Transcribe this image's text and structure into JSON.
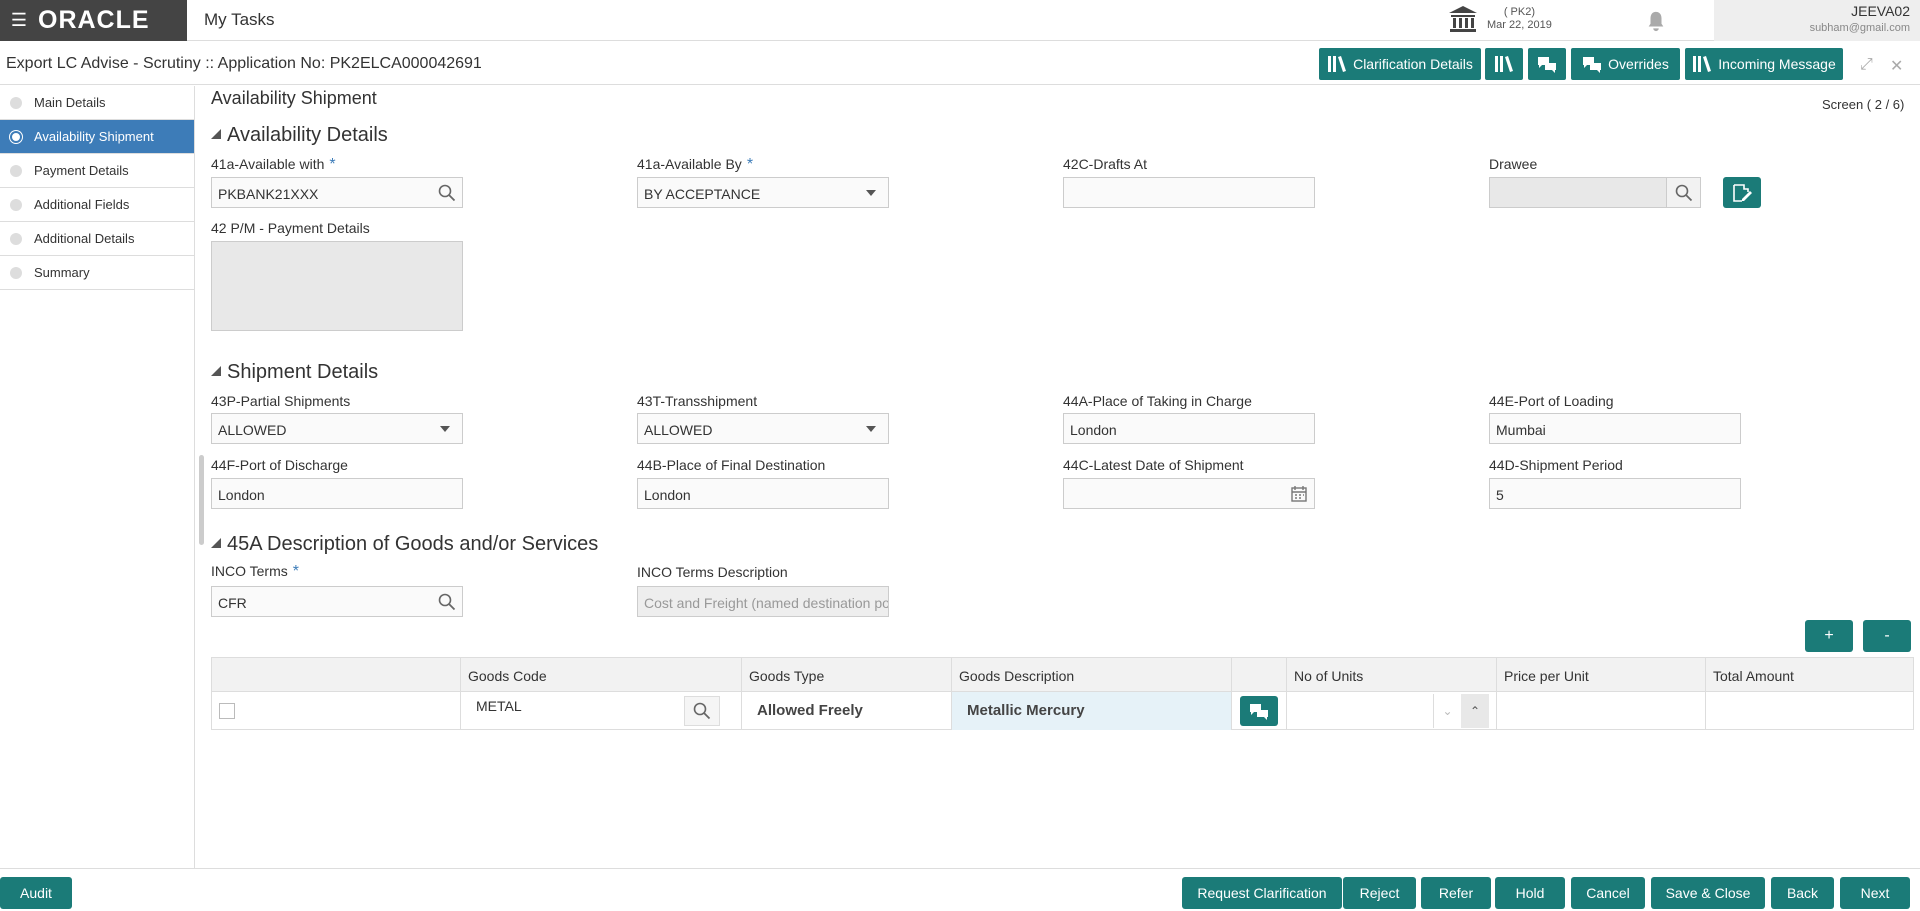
{
  "header": {
    "logo": "ORACLE",
    "app_title": "My Tasks",
    "branch_code": "( PK2)",
    "branch_date": "Mar 22, 2019",
    "username": "JEEVA02",
    "email": "subham@gmail.com"
  },
  "subheader": {
    "title": "Export LC Advise - Scrutiny :: Application No: PK2ELCA000042691",
    "clarification_details": "Clarification Details",
    "overrides": "Overrides",
    "incoming_message": "Incoming Message"
  },
  "sidebar": {
    "items": [
      {
        "label": "Main Details"
      },
      {
        "label": "Availability Shipment"
      },
      {
        "label": "Payment Details"
      },
      {
        "label": "Additional Fields"
      },
      {
        "label": "Additional Details"
      },
      {
        "label": "Summary"
      }
    ]
  },
  "page": {
    "title": "Availability Shipment",
    "screen": "Screen ( 2 / 6)"
  },
  "availability": {
    "heading": "Availability Details",
    "available_with_label": "41a-Available with",
    "available_with_value": "PKBANK21XXX",
    "available_by_label": "41a-Available By",
    "available_by_value": "BY ACCEPTANCE",
    "drafts_at_label": "42C-Drafts At",
    "drafts_at_value": "",
    "drawee_label": "Drawee",
    "drawee_value": "",
    "payment_details_label": "42 P/M - Payment Details"
  },
  "shipment": {
    "heading": "Shipment Details",
    "partial_label": "43P-Partial Shipments",
    "partial_value": "ALLOWED",
    "transship_label": "43T-Transshipment",
    "transship_value": "ALLOWED",
    "taking_charge_label": "44A-Place of Taking in Charge",
    "taking_charge_value": "London",
    "port_loading_label": "44E-Port of Loading",
    "port_loading_value": "Mumbai",
    "port_discharge_label": "44F-Port of Discharge",
    "port_discharge_value": "London",
    "final_dest_label": "44B-Place of Final Destination",
    "final_dest_value": "London",
    "latest_date_label": "44C-Latest Date of Shipment",
    "latest_date_value": "",
    "period_label": "44D-Shipment Period",
    "period_value": "5"
  },
  "goods": {
    "heading": "45A Description of Goods and/or Services",
    "inco_label": "INCO Terms",
    "inco_value": "CFR",
    "inco_desc_label": "INCO Terms Description",
    "inco_desc_value": "Cost and Freight (named destination po"
  },
  "table": {
    "add": "+",
    "remove": "-",
    "columns": [
      "Goods Code",
      "Goods Type",
      "Goods Description",
      "No of Units",
      "Price per Unit",
      "Total Amount"
    ],
    "rows": [
      {
        "code": "METAL",
        "type": "Allowed Freely",
        "description": "Metallic Mercury",
        "units": "",
        "price": "",
        "total": ""
      }
    ]
  },
  "footer": {
    "audit": "Audit",
    "request_clarification": "Request Clarification",
    "reject": "Reject",
    "refer": "Refer",
    "hold": "Hold",
    "cancel": "Cancel",
    "save_close": "Save & Close",
    "back": "Back",
    "next": "Next"
  }
}
